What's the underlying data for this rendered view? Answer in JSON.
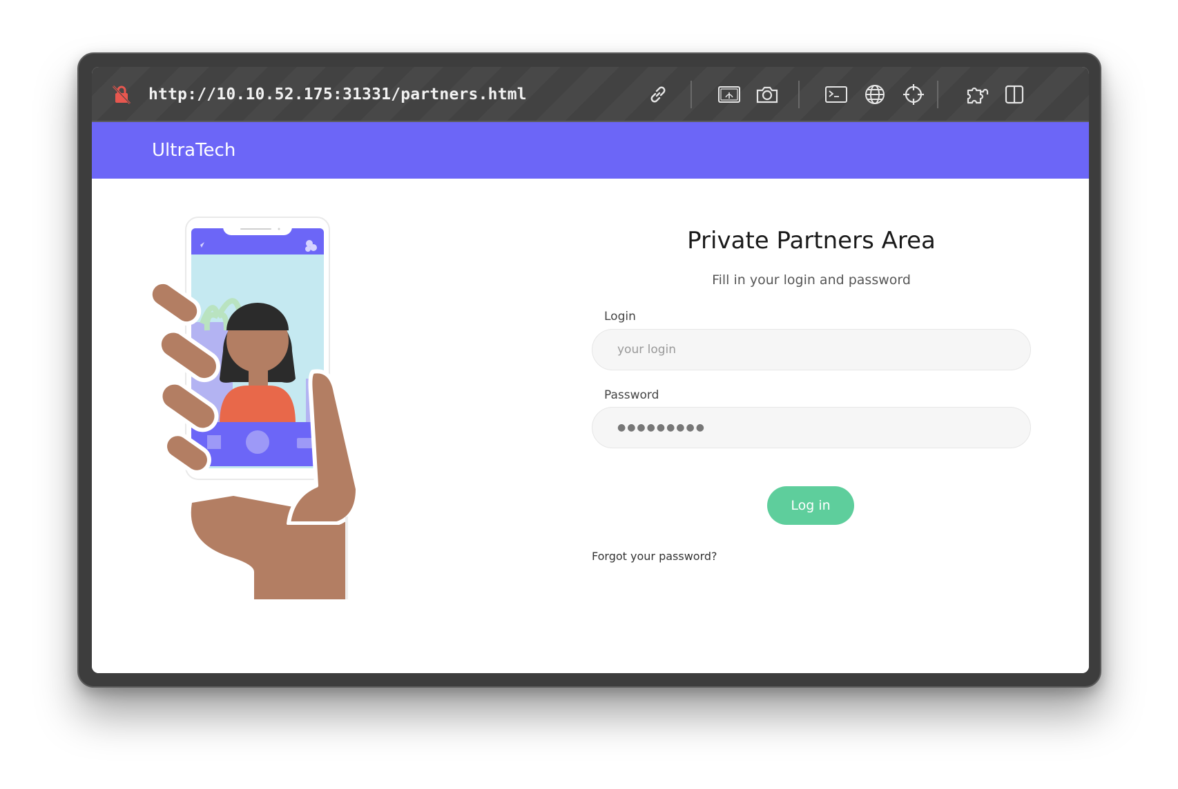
{
  "browser": {
    "url": "http://10.10.52.175:31331/partners.html",
    "security_icon": "insecure-lock-icon",
    "toolbar_icons": [
      "link-icon",
      "image-icon",
      "camera-icon",
      "terminal-icon",
      "globe-icon",
      "crosshair-icon",
      "extensions-icon",
      "split-view-icon"
    ]
  },
  "navbar": {
    "brand": "UltraTech",
    "color": "#6c66f7"
  },
  "form": {
    "title": "Private Partners Area",
    "subtitle": "Fill in your login and password",
    "login_label": "Login",
    "login_placeholder": "your login",
    "password_label": "Password",
    "password_value": "●●●●●●●●●",
    "submit_label": "Log in",
    "submit_color": "#5ece9c",
    "forgot_link": "Forgot your password?"
  }
}
